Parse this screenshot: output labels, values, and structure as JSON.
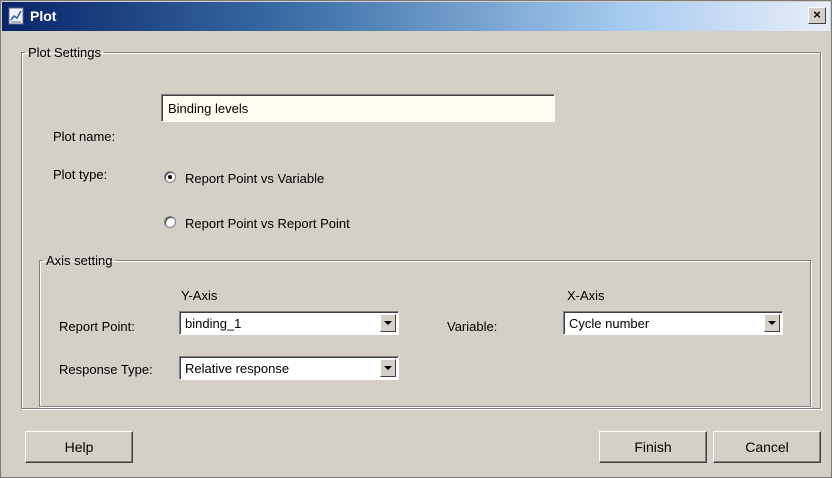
{
  "window": {
    "title": "Plot",
    "icon": "plot-icon",
    "close_label": "×"
  },
  "plot_settings": {
    "legend": "Plot Settings",
    "plot_name_label": "Plot name:",
    "plot_name_value": "Binding levels",
    "plot_type_label": "Plot type:",
    "plot_type_options": [
      {
        "label": "Report Point vs Variable",
        "selected": true
      },
      {
        "label": "Report Point vs Report Point",
        "selected": false
      }
    ]
  },
  "axis_setting": {
    "legend": "Axis setting",
    "y_axis_heading": "Y-Axis",
    "x_axis_heading": "X-Axis",
    "report_point_label": "Report Point:",
    "report_point_value": "binding_1",
    "response_type_label": "Response Type:",
    "response_type_value": "Relative response",
    "variable_label": "Variable:",
    "variable_value": "Cycle number"
  },
  "buttons": {
    "help": "Help",
    "finish": "Finish",
    "cancel": "Cancel"
  }
}
